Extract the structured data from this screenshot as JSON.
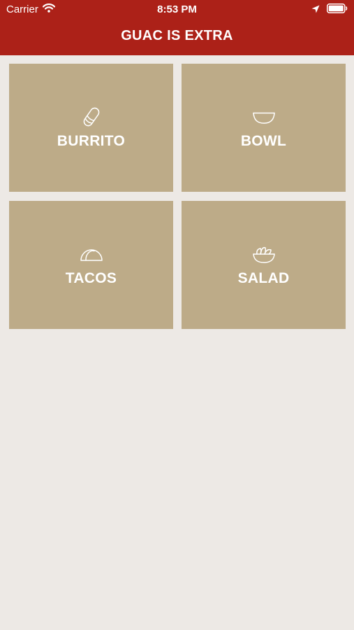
{
  "status_bar": {
    "carrier": "Carrier",
    "time": "8:53 PM",
    "icons": [
      "wifi-icon",
      "location-arrow-icon",
      "battery-icon"
    ]
  },
  "nav": {
    "title": "GUAC IS EXTRA"
  },
  "menu": {
    "items": [
      {
        "label": "BURRITO",
        "icon": "burrito-icon"
      },
      {
        "label": "BOWL",
        "icon": "bowl-icon"
      },
      {
        "label": "TACOS",
        "icon": "taco-icon"
      },
      {
        "label": "SALAD",
        "icon": "salad-icon"
      }
    ]
  },
  "colors": {
    "header_bg": "#ac2118",
    "tile_bg": "#bdab88",
    "page_bg": "#ede9e5",
    "text": "#ffffff"
  }
}
